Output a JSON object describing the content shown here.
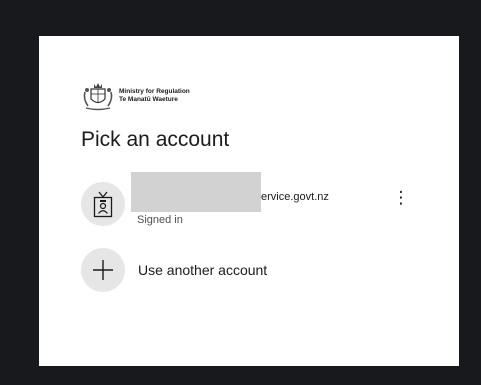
{
  "org": {
    "name": "Ministry for Regulation",
    "maori_name": "Te Manatū Waeture",
    "logo_icon": "nz-coat-of-arms-icon"
  },
  "page": {
    "title": "Pick an account"
  },
  "account": {
    "email_suffix": "ervice.govt.nz",
    "status": "Signed in",
    "avatar_icon": "badge-person-icon",
    "more_icon": "more-options-icon",
    "more_glyph": "⋮"
  },
  "another_account": {
    "label": "Use another account",
    "icon": "plus-icon"
  },
  "colors": {
    "background": "#17191c",
    "card": "#ffffff",
    "avatar_bg": "#e6e6e6",
    "redaction": "#d2d2d2",
    "text": "#1b1b1b"
  }
}
